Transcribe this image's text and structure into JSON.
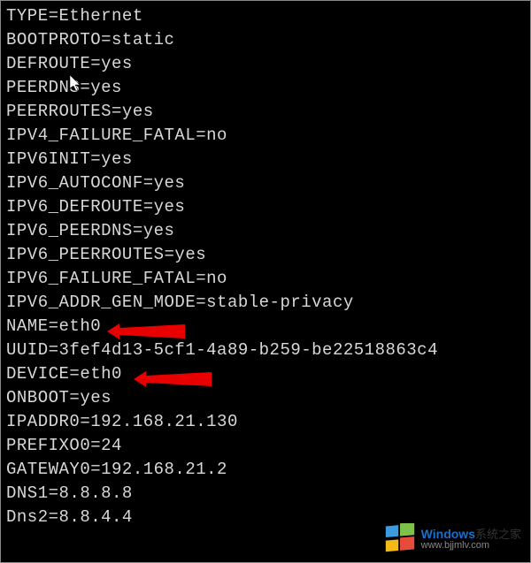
{
  "config_lines": [
    "TYPE=Ethernet",
    "BOOTPROTO=static",
    "DEFROUTE=yes",
    "PEERDNS=yes",
    "PEERROUTES=yes",
    "IPV4_FAILURE_FATAL=no",
    "IPV6INIT=yes",
    "IPV6_AUTOCONF=yes",
    "IPV6_DEFROUTE=yes",
    "IPV6_PEERDNS=yes",
    "IPV6_PEERROUTES=yes",
    "IPV6_FAILURE_FATAL=no",
    "IPV6_ADDR_GEN_MODE=stable-privacy",
    "NAME=eth0",
    "UUID=3fef4d13-5cf1-4a89-b259-be22518863c4",
    "DEVICE=eth0",
    "ONBOOT=yes",
    "IPADDR0=192.168.21.130",
    "PREFIXO0=24",
    "GATEWAY0=192.168.21.2",
    "DNS1=8.8.8.8",
    "Dns2=8.8.4.4"
  ],
  "watermark": {
    "brand": "Windows",
    "suffix": "系统之家",
    "url": "www.bjjmlv.com"
  }
}
